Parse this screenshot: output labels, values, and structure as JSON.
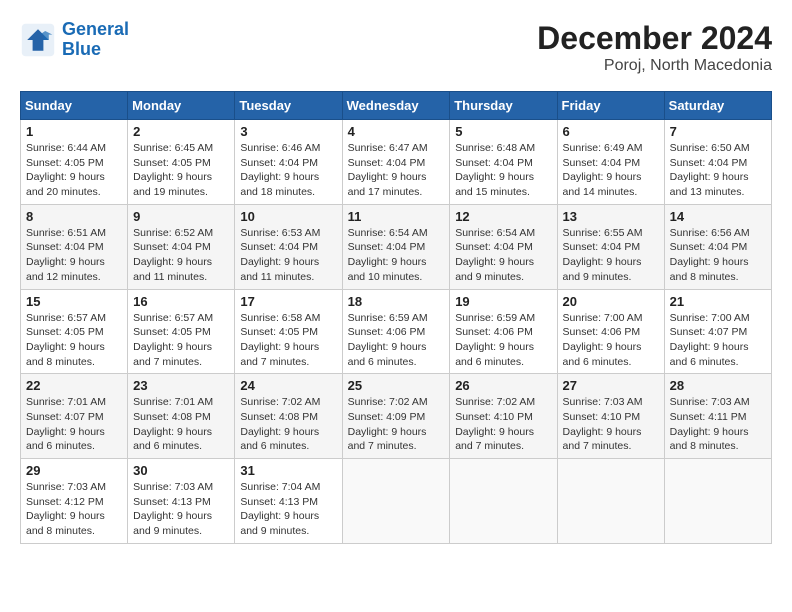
{
  "header": {
    "logo_line1": "General",
    "logo_line2": "Blue",
    "month": "December 2024",
    "location": "Poroj, North Macedonia"
  },
  "days_of_week": [
    "Sunday",
    "Monday",
    "Tuesday",
    "Wednesday",
    "Thursday",
    "Friday",
    "Saturday"
  ],
  "weeks": [
    [
      {
        "day": "1",
        "sunrise": "6:44 AM",
        "sunset": "4:05 PM",
        "daylight": "9 hours and 20 minutes."
      },
      {
        "day": "2",
        "sunrise": "6:45 AM",
        "sunset": "4:05 PM",
        "daylight": "9 hours and 19 minutes."
      },
      {
        "day": "3",
        "sunrise": "6:46 AM",
        "sunset": "4:04 PM",
        "daylight": "9 hours and 18 minutes."
      },
      {
        "day": "4",
        "sunrise": "6:47 AM",
        "sunset": "4:04 PM",
        "daylight": "9 hours and 17 minutes."
      },
      {
        "day": "5",
        "sunrise": "6:48 AM",
        "sunset": "4:04 PM",
        "daylight": "9 hours and 15 minutes."
      },
      {
        "day": "6",
        "sunrise": "6:49 AM",
        "sunset": "4:04 PM",
        "daylight": "9 hours and 14 minutes."
      },
      {
        "day": "7",
        "sunrise": "6:50 AM",
        "sunset": "4:04 PM",
        "daylight": "9 hours and 13 minutes."
      }
    ],
    [
      {
        "day": "8",
        "sunrise": "6:51 AM",
        "sunset": "4:04 PM",
        "daylight": "9 hours and 12 minutes."
      },
      {
        "day": "9",
        "sunrise": "6:52 AM",
        "sunset": "4:04 PM",
        "daylight": "9 hours and 11 minutes."
      },
      {
        "day": "10",
        "sunrise": "6:53 AM",
        "sunset": "4:04 PM",
        "daylight": "9 hours and 11 minutes."
      },
      {
        "day": "11",
        "sunrise": "6:54 AM",
        "sunset": "4:04 PM",
        "daylight": "9 hours and 10 minutes."
      },
      {
        "day": "12",
        "sunrise": "6:54 AM",
        "sunset": "4:04 PM",
        "daylight": "9 hours and 9 minutes."
      },
      {
        "day": "13",
        "sunrise": "6:55 AM",
        "sunset": "4:04 PM",
        "daylight": "9 hours and 9 minutes."
      },
      {
        "day": "14",
        "sunrise": "6:56 AM",
        "sunset": "4:04 PM",
        "daylight": "9 hours and 8 minutes."
      }
    ],
    [
      {
        "day": "15",
        "sunrise": "6:57 AM",
        "sunset": "4:05 PM",
        "daylight": "9 hours and 8 minutes."
      },
      {
        "day": "16",
        "sunrise": "6:57 AM",
        "sunset": "4:05 PM",
        "daylight": "9 hours and 7 minutes."
      },
      {
        "day": "17",
        "sunrise": "6:58 AM",
        "sunset": "4:05 PM",
        "daylight": "9 hours and 7 minutes."
      },
      {
        "day": "18",
        "sunrise": "6:59 AM",
        "sunset": "4:06 PM",
        "daylight": "9 hours and 6 minutes."
      },
      {
        "day": "19",
        "sunrise": "6:59 AM",
        "sunset": "4:06 PM",
        "daylight": "9 hours and 6 minutes."
      },
      {
        "day": "20",
        "sunrise": "7:00 AM",
        "sunset": "4:06 PM",
        "daylight": "9 hours and 6 minutes."
      },
      {
        "day": "21",
        "sunrise": "7:00 AM",
        "sunset": "4:07 PM",
        "daylight": "9 hours and 6 minutes."
      }
    ],
    [
      {
        "day": "22",
        "sunrise": "7:01 AM",
        "sunset": "4:07 PM",
        "daylight": "9 hours and 6 minutes."
      },
      {
        "day": "23",
        "sunrise": "7:01 AM",
        "sunset": "4:08 PM",
        "daylight": "9 hours and 6 minutes."
      },
      {
        "day": "24",
        "sunrise": "7:02 AM",
        "sunset": "4:08 PM",
        "daylight": "9 hours and 6 minutes."
      },
      {
        "day": "25",
        "sunrise": "7:02 AM",
        "sunset": "4:09 PM",
        "daylight": "9 hours and 7 minutes."
      },
      {
        "day": "26",
        "sunrise": "7:02 AM",
        "sunset": "4:10 PM",
        "daylight": "9 hours and 7 minutes."
      },
      {
        "day": "27",
        "sunrise": "7:03 AM",
        "sunset": "4:10 PM",
        "daylight": "9 hours and 7 minutes."
      },
      {
        "day": "28",
        "sunrise": "7:03 AM",
        "sunset": "4:11 PM",
        "daylight": "9 hours and 8 minutes."
      }
    ],
    [
      {
        "day": "29",
        "sunrise": "7:03 AM",
        "sunset": "4:12 PM",
        "daylight": "9 hours and 8 minutes."
      },
      {
        "day": "30",
        "sunrise": "7:03 AM",
        "sunset": "4:13 PM",
        "daylight": "9 hours and 9 minutes."
      },
      {
        "day": "31",
        "sunrise": "7:04 AM",
        "sunset": "4:13 PM",
        "daylight": "9 hours and 9 minutes."
      },
      null,
      null,
      null,
      null
    ]
  ]
}
